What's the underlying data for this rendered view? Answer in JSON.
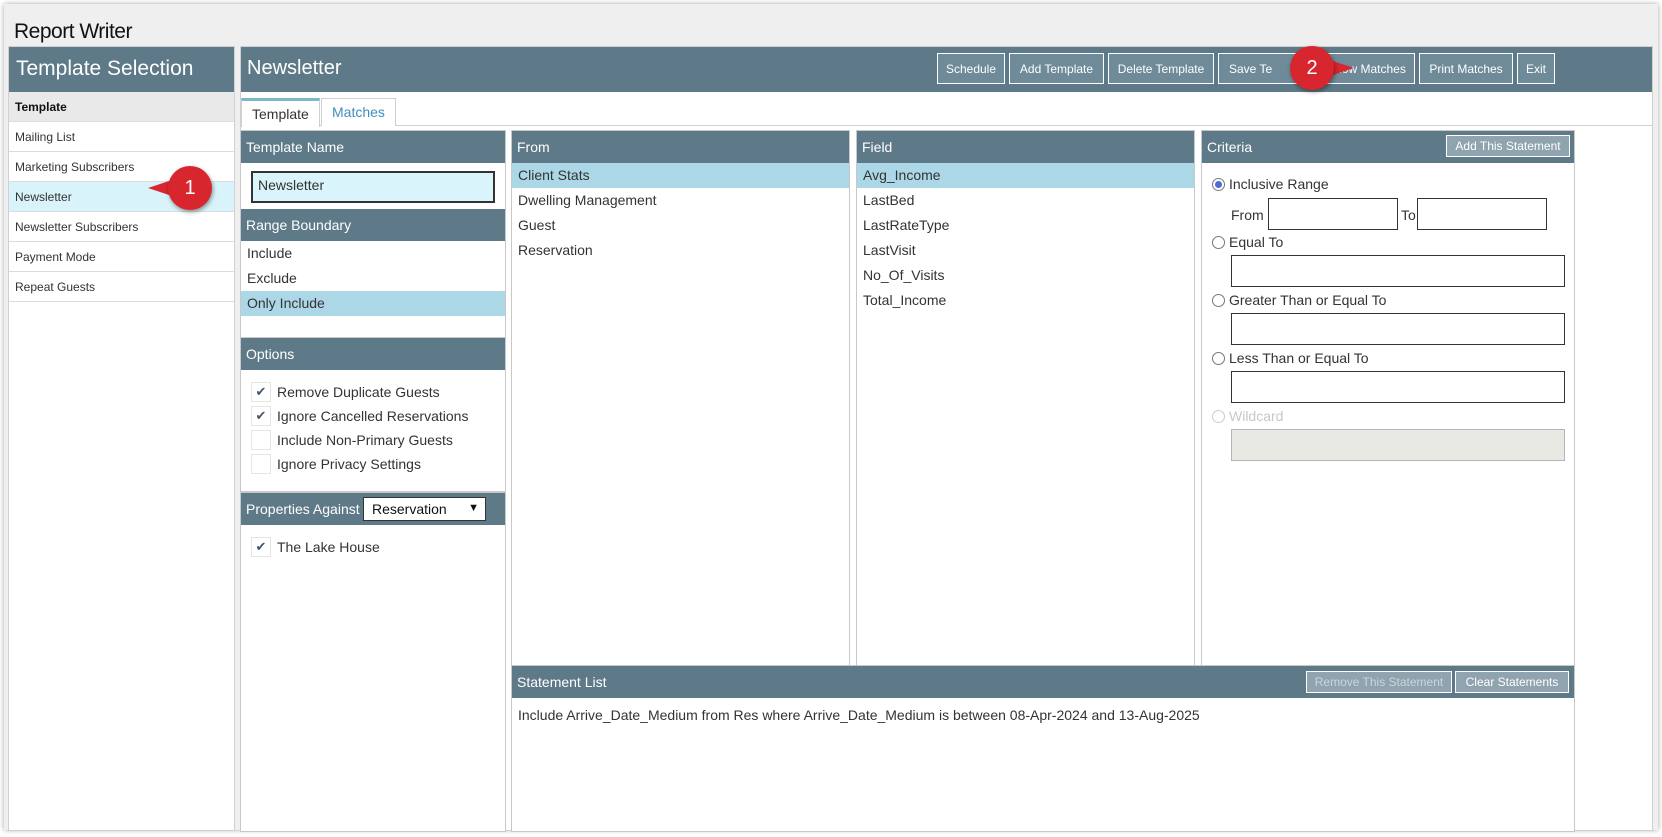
{
  "app": {
    "title": "Report Writer"
  },
  "sidebar": {
    "title": "Template Selection",
    "header_item": "Template",
    "items": [
      {
        "label": "Mailing List",
        "active": false
      },
      {
        "label": "Marketing Subscribers",
        "active": false
      },
      {
        "label": "Newsletter",
        "active": true
      },
      {
        "label": "Newsletter Subscribers",
        "active": false
      },
      {
        "label": "Payment Mode",
        "active": false
      },
      {
        "label": "Repeat Guests",
        "active": false
      }
    ]
  },
  "main": {
    "title": "Newsletter",
    "toolbar": {
      "schedule": "Schedule",
      "add_template": "Add Template",
      "delete_template": "Delete Template",
      "save_template": "Save Te",
      "show_matches": "Show Matches",
      "print_matches": "Print Matches",
      "exit": "Exit"
    },
    "tabs": {
      "template": "Template",
      "matches": "Matches"
    }
  },
  "template_name": {
    "heading": "Template Name",
    "value": "Newsletter"
  },
  "range_boundary": {
    "heading": "Range Boundary",
    "options": [
      "Include",
      "Exclude",
      "Only Include"
    ],
    "selected": "Only Include"
  },
  "options": {
    "heading": "Options",
    "items": [
      {
        "label": "Remove Duplicate Guests",
        "checked": true
      },
      {
        "label": "Ignore Cancelled Reservations",
        "checked": true
      },
      {
        "label": "Include Non-Primary Guests",
        "checked": false
      },
      {
        "label": "Ignore Privacy Settings",
        "checked": false
      }
    ]
  },
  "properties": {
    "heading": "Properties Against",
    "select_value": "Reservation",
    "items": [
      {
        "label": "The Lake House",
        "checked": true
      }
    ]
  },
  "from": {
    "heading": "From",
    "items": [
      "Client Stats",
      "Dwelling Management",
      "Guest",
      "Reservation"
    ],
    "selected": "Client Stats"
  },
  "field": {
    "heading": "Field",
    "items": [
      "Avg_Income",
      "LastBed",
      "LastRateType",
      "LastVisit",
      "No_Of_Visits",
      "Total_Income"
    ],
    "selected": "Avg_Income"
  },
  "criteria": {
    "heading": "Criteria",
    "add_button": "Add This Statement",
    "inclusive_range": "Inclusive Range",
    "from_label": "From",
    "to_label": "To",
    "equal_to": "Equal To",
    "greater_than": "Greater Than or Equal To",
    "less_than": "Less Than or Equal To",
    "wildcard": "Wildcard",
    "selected": "Inclusive Range"
  },
  "statement_list": {
    "heading": "Statement List",
    "remove_button": "Remove This Statement",
    "clear_button": "Clear Statements",
    "statements": [
      "Include Arrive_Date_Medium from Res where Arrive_Date_Medium is between 08-Apr-2024 and 13-Aug-2025"
    ]
  },
  "callouts": {
    "one": "1",
    "two": "2"
  },
  "icons": {
    "check": "check-icon",
    "caret": "chevron-down-icon"
  },
  "colors": {
    "header": "#5e7987",
    "selected_row": "#acd7e6",
    "callout": "#d8262e"
  }
}
